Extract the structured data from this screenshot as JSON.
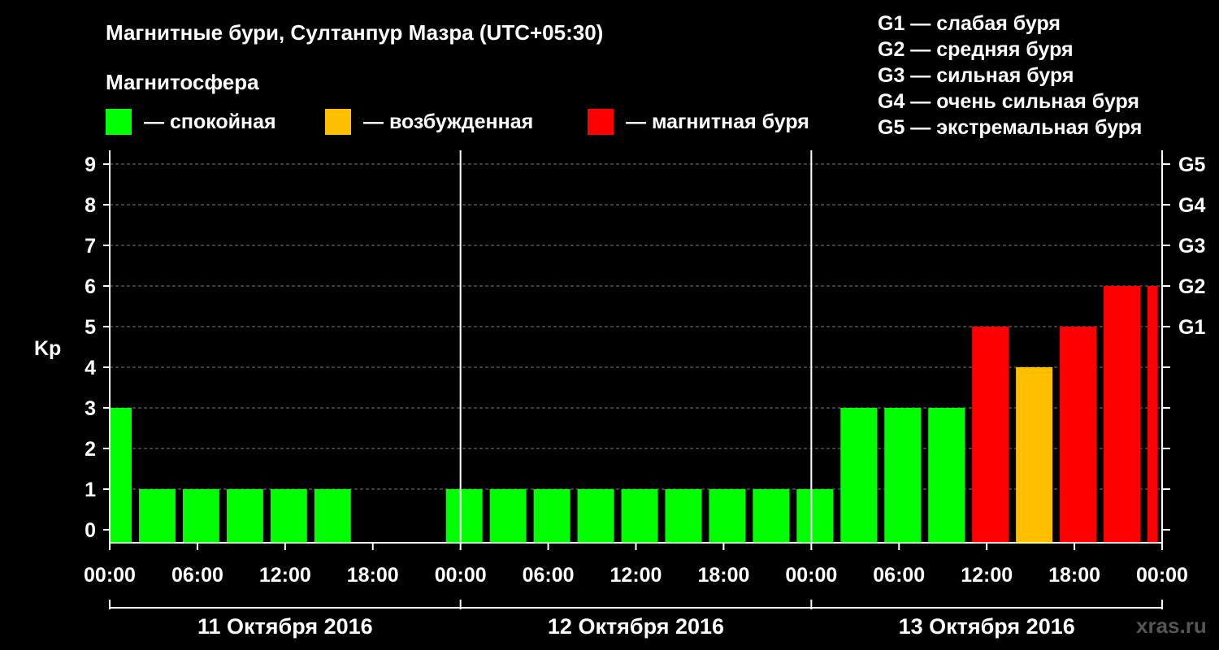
{
  "chart_data": {
    "type": "bar",
    "title": "Магнитные бури, Султанпур Мазра (UTC+05:30)",
    "legend_title": "Магнитосфера",
    "legend": [
      {
        "label": "— спокойная",
        "color": "#00ff00"
      },
      {
        "label": "— возбужденная",
        "color": "#ffbf00"
      },
      {
        "label": "— магнитная буря",
        "color": "#ff0000"
      }
    ],
    "g_scale_legend": [
      "G1 — слабая буря",
      "G2 — средняя буря",
      "G3 — сильная буря",
      "G4 — очень сильная буря",
      "G5 — экстремальная буря"
    ],
    "ylabel": "Kp",
    "ylim": [
      0,
      9
    ],
    "y_ticks": [
      "0",
      "1",
      "2",
      "3",
      "4",
      "5",
      "6",
      "7",
      "8",
      "9"
    ],
    "right_ticks": [
      {
        "value": 5,
        "label": "G1"
      },
      {
        "value": 6,
        "label": "G2"
      },
      {
        "value": 7,
        "label": "G3"
      },
      {
        "value": 8,
        "label": "G4"
      },
      {
        "value": 9,
        "label": "G5"
      }
    ],
    "x_range_hours": [
      0,
      72
    ],
    "x_tick_labels": [
      "00:00",
      "06:00",
      "12:00",
      "18:00",
      "00:00",
      "06:00",
      "12:00",
      "18:00",
      "00:00",
      "06:00",
      "12:00",
      "18:00",
      "00:00"
    ],
    "days": [
      "11 Октября 2016",
      "12 Октября 2016",
      "13 Октября 2016"
    ],
    "grid": true,
    "bars": [
      {
        "start": 0,
        "end": 1.5,
        "kp": 3,
        "level": "quiet"
      },
      {
        "start": 2,
        "end": 4.5,
        "kp": 1,
        "level": "quiet"
      },
      {
        "start": 5,
        "end": 7.5,
        "kp": 1,
        "level": "quiet"
      },
      {
        "start": 8,
        "end": 10.5,
        "kp": 1,
        "level": "quiet"
      },
      {
        "start": 11,
        "end": 13.5,
        "kp": 1,
        "level": "quiet"
      },
      {
        "start": 14,
        "end": 16.5,
        "kp": 1,
        "level": "quiet"
      },
      {
        "start": 23,
        "end": 25.5,
        "kp": 1,
        "level": "quiet"
      },
      {
        "start": 26,
        "end": 28.5,
        "kp": 1,
        "level": "quiet"
      },
      {
        "start": 29,
        "end": 31.5,
        "kp": 1,
        "level": "quiet"
      },
      {
        "start": 32,
        "end": 34.5,
        "kp": 1,
        "level": "quiet"
      },
      {
        "start": 35,
        "end": 37.5,
        "kp": 1,
        "level": "quiet"
      },
      {
        "start": 38,
        "end": 40.5,
        "kp": 1,
        "level": "quiet"
      },
      {
        "start": 41,
        "end": 43.5,
        "kp": 1,
        "level": "quiet"
      },
      {
        "start": 44,
        "end": 46.5,
        "kp": 1,
        "level": "quiet"
      },
      {
        "start": 47,
        "end": 49.5,
        "kp": 1,
        "level": "quiet"
      },
      {
        "start": 50,
        "end": 52.5,
        "kp": 3,
        "level": "quiet"
      },
      {
        "start": 53,
        "end": 55.5,
        "kp": 3,
        "level": "quiet"
      },
      {
        "start": 56,
        "end": 58.5,
        "kp": 3,
        "level": "quiet"
      },
      {
        "start": 59,
        "end": 61.5,
        "kp": 5,
        "level": "storm"
      },
      {
        "start": 62,
        "end": 64.5,
        "kp": 4,
        "level": "active"
      },
      {
        "start": 65,
        "end": 67.5,
        "kp": 5,
        "level": "storm"
      },
      {
        "start": 68,
        "end": 70.5,
        "kp": 6,
        "level": "storm"
      },
      {
        "start": 71,
        "end": 71.7,
        "kp": 6,
        "level": "storm"
      }
    ],
    "level_colors": {
      "quiet": "#00ff00",
      "active": "#ffbf00",
      "storm": "#ff0000"
    }
  },
  "watermark": "xras.ru"
}
